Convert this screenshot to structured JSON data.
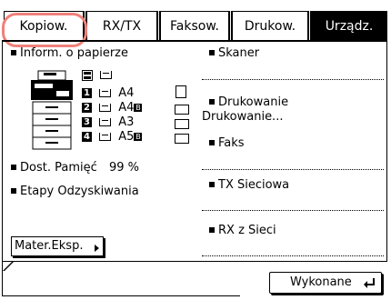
{
  "tabs": [
    {
      "label": "Kopiow.",
      "active": false
    },
    {
      "label": "RX/TX",
      "active": false
    },
    {
      "label": "Faksow.",
      "active": false
    },
    {
      "label": "Drukow.",
      "active": false
    },
    {
      "label": "Urządz.",
      "active": true
    }
  ],
  "left": {
    "paper_info_label": "Inform. o papierze",
    "paper_rows": [
      {
        "num": "1",
        "size": "A4",
        "badge": ""
      },
      {
        "num": "2",
        "size": "A4",
        "badge": "B"
      },
      {
        "num": "3",
        "size": "A3",
        "badge": ""
      },
      {
        "num": "4",
        "size": "A5",
        "badge": "B"
      }
    ],
    "memory_label": "Dost. Pamięć",
    "memory_value": "99 %",
    "recovery_label": "Etapy Odzyskiwania"
  },
  "right": {
    "scanner": "Skaner",
    "printing": "Drukowanie",
    "printing_sub": "Drukowanie...",
    "fax": "Faks",
    "tx_network": "TX Sieciowa",
    "rx_network": "RX z Sieci"
  },
  "buttons": {
    "materials": "Mater.Eksp.",
    "done": "Wykonane"
  }
}
